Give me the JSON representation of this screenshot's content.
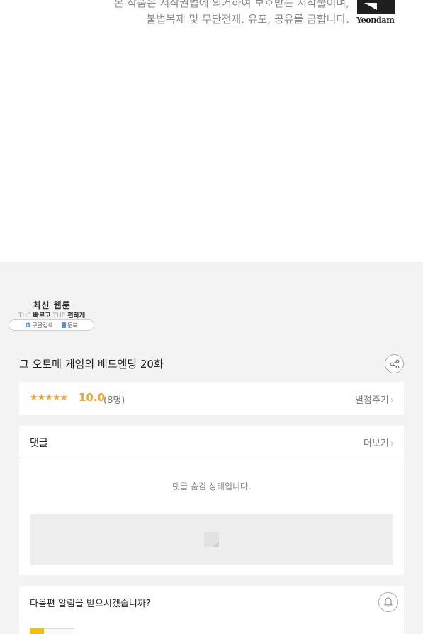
{
  "copyright": {
    "line1": "본 작품은 저작권법에 의거하여 보호받는 저작물이며,",
    "line2": "불법복제 및 무단전재, 유포, 공유를 금합니다."
  },
  "publisher_logo": {
    "text": "Yeondam"
  },
  "banner": {
    "title": "최신 웹툰",
    "sub_the1": "THE",
    "sub_fast": "빠르고",
    "sub_the2": "THE",
    "sub_easy": "편하게",
    "google_label": "구글검색",
    "toonbook_label": "툰북"
  },
  "episode": {
    "title": "그 오토메 게임의 배드엔딩 20화",
    "share_icon": "share-icon"
  },
  "rating": {
    "stars": "★★★★★",
    "score": "10.0",
    "count": "(8명)",
    "rate_action": "별점주기"
  },
  "comments": {
    "title": "댓글",
    "more": "더보기",
    "hidden_message": "댓글 숨김 상태입니다."
  },
  "notify": {
    "question": "다음편 알림을 받으시겠습니까?",
    "bell_icon": "bell-icon"
  },
  "colors": {
    "accent": "#f5a623",
    "gray_bg": "#f3f3f3",
    "toggle_on": "#f2c200"
  }
}
